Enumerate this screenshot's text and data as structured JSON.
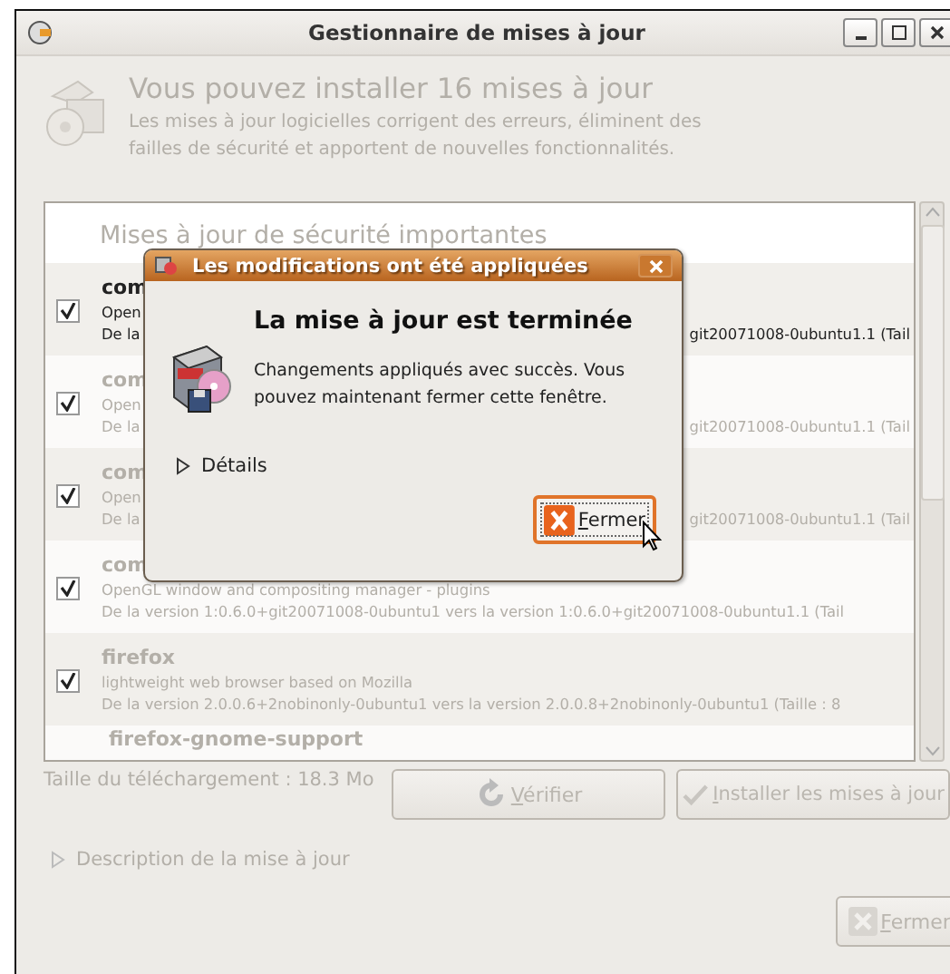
{
  "window": {
    "title": "Gestionnaire de mises à jour",
    "insensitive": true
  },
  "header": {
    "heading": "Vous pouvez installer 16 mises à jour",
    "text": "Les mises à jour logicielles corrigent des erreurs, éliminent des failles de sécurité et apportent de nouvelles fonctionnalités."
  },
  "update_list": {
    "section": "Mises à jour de sécurité importantes",
    "rows": [
      {
        "checked": true,
        "selected": true,
        "name": "com",
        "description": "Open",
        "version": "De la",
        "version_end": "git20071008-0ubuntu1.1 (Tail"
      },
      {
        "checked": true,
        "selected": false,
        "name": "com",
        "description": "Open",
        "version": "De la",
        "version_end": "git20071008-0ubuntu1.1 (Tail"
      },
      {
        "checked": true,
        "selected": false,
        "name": "com",
        "description": "Open",
        "version": "De la",
        "version_end": "git20071008-0ubuntu1.1 (Tail"
      },
      {
        "checked": true,
        "selected": false,
        "name": "com",
        "description": "OpenGL window and compositing manager - plugins",
        "version": "De la version 1:0.6.0+git20071008-0ubuntu1 vers la version 1:0.6.0+git20071008-0ubuntu1.1 (Tail"
      },
      {
        "checked": true,
        "selected": false,
        "name": "firefox",
        "description": "lightweight web browser based on Mozilla",
        "version": "De la version 2.0.0.6+2nobinonly-0ubuntu1 vers la version 2.0.0.8+2nobinonly-0ubuntu1 (Taille : 8"
      }
    ],
    "partial_row": {
      "name": "firefox-gnome-support"
    }
  },
  "download_size": "Taille du téléchargement : 18.3 Mo",
  "actions": [
    {
      "kind": "refresh",
      "label": "Vérifier",
      "disabled": true
    },
    {
      "kind": "install",
      "label": "Installer les mises à jour",
      "disabled": true
    }
  ],
  "description_expander": {
    "label": "Description de la mise à jour",
    "expanded": false
  },
  "close_button": {
    "label": "Fermer",
    "disabled": true
  },
  "dialog": {
    "title": "Les modifications ont été appliquées",
    "heading": "La mise à jour est terminée",
    "message": "Changements appliqués avec succès. Vous pouvez maintenant fermer cette fenêtre.",
    "details": {
      "label": "Détails",
      "expanded": false
    },
    "button": {
      "label": "Fermer",
      "focused": true
    }
  }
}
